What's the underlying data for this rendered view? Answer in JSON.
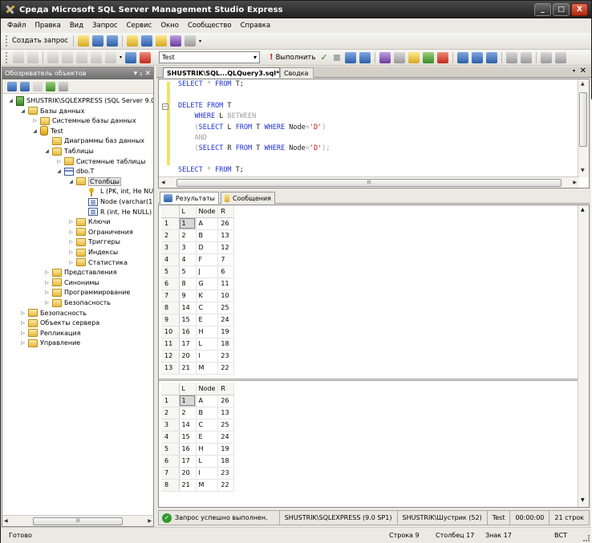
{
  "window": {
    "title": "Среда Microsoft SQL Server Management Studio Express",
    "min": "_",
    "max": "□",
    "close": "X"
  },
  "menu": [
    "Файл",
    "Правка",
    "Вид",
    "Запрос",
    "Сервис",
    "Окно",
    "Сообщество",
    "Справка"
  ],
  "toolbar": {
    "new_query_label": "Создать запрос",
    "database": "Test",
    "execute_label": "Выполнить"
  },
  "object_explorer": {
    "title": "Обозреватель объектов",
    "pin": "▾ ₁ ✕",
    "tree": [
      {
        "label": "SHUSTRIK\\SQLEXPRESS (SQL Server 9.0",
        "depth": 0,
        "twisty": "◢",
        "icon": "server"
      },
      {
        "label": "Базы данных",
        "depth": 1,
        "twisty": "◢",
        "icon": "folder"
      },
      {
        "label": "Системные базы данных",
        "depth": 2,
        "twisty": "▷",
        "icon": "folder"
      },
      {
        "label": "Test",
        "depth": 2,
        "twisty": "◢",
        "icon": "db"
      },
      {
        "label": "Диаграммы баз данных",
        "depth": 3,
        "twisty": "",
        "icon": "folder"
      },
      {
        "label": "Таблицы",
        "depth": 3,
        "twisty": "◢",
        "icon": "folder"
      },
      {
        "label": "Системные таблицы",
        "depth": 4,
        "twisty": "▷",
        "icon": "folder"
      },
      {
        "label": "dbo.T",
        "depth": 4,
        "twisty": "◢",
        "icon": "table"
      },
      {
        "label": "Столбцы",
        "depth": 5,
        "twisty": "◢",
        "icon": "folder",
        "selected": true
      },
      {
        "label": "L (PK, int, Не NUL",
        "depth": 6,
        "twisty": "",
        "icon": "key"
      },
      {
        "label": "Node (varchar(1",
        "depth": 6,
        "twisty": "",
        "icon": "col"
      },
      {
        "label": "R (int, Не NULL)",
        "depth": 6,
        "twisty": "",
        "icon": "col"
      },
      {
        "label": "Ключи",
        "depth": 5,
        "twisty": "▷",
        "icon": "folder"
      },
      {
        "label": "Ограничения",
        "depth": 5,
        "twisty": "▷",
        "icon": "folder"
      },
      {
        "label": "Триггеры",
        "depth": 5,
        "twisty": "▷",
        "icon": "folder"
      },
      {
        "label": "Индексы",
        "depth": 5,
        "twisty": "▷",
        "icon": "folder"
      },
      {
        "label": "Статистика",
        "depth": 5,
        "twisty": "▷",
        "icon": "folder"
      },
      {
        "label": "Представления",
        "depth": 3,
        "twisty": "▷",
        "icon": "folder"
      },
      {
        "label": "Синонимы",
        "depth": 3,
        "twisty": "▷",
        "icon": "folder"
      },
      {
        "label": "Программирование",
        "depth": 3,
        "twisty": "▷",
        "icon": "folder"
      },
      {
        "label": "Безопасность",
        "depth": 3,
        "twisty": "▷",
        "icon": "folder"
      },
      {
        "label": "Безопасность",
        "depth": 1,
        "twisty": "▷",
        "icon": "folder"
      },
      {
        "label": "Объекты сервера",
        "depth": 1,
        "twisty": "▷",
        "icon": "folder"
      },
      {
        "label": "Репликация",
        "depth": 1,
        "twisty": "▷",
        "icon": "folder"
      },
      {
        "label": "Управление",
        "depth": 1,
        "twisty": "▷",
        "icon": "folder"
      }
    ]
  },
  "doc_tabs": {
    "active": "SHUSTRIK\\SQL...QLQuery3.sql*",
    "inactive": "Сводка",
    "close": "✕"
  },
  "editor": {
    "lines": [
      [
        [
          "kw",
          "SELECT "
        ],
        [
          "kg",
          "* "
        ],
        [
          "kw",
          "FROM "
        ],
        [
          "kd",
          "T;"
        ]
      ],
      [],
      [
        [
          "kw",
          "DELETE FROM "
        ],
        [
          "kd",
          "T"
        ]
      ],
      [
        [
          "kd",
          "    "
        ],
        [
          "kw",
          "WHERE "
        ],
        [
          "kd",
          "L "
        ],
        [
          "kg",
          "BETWEEN"
        ]
      ],
      [
        [
          "kd",
          "    "
        ],
        [
          "kg",
          "("
        ],
        [
          "kw",
          "SELECT "
        ],
        [
          "kd",
          "L "
        ],
        [
          "kw",
          "FROM "
        ],
        [
          "kd",
          "T "
        ],
        [
          "kw",
          "WHERE "
        ],
        [
          "kd",
          "Node"
        ],
        [
          "kg",
          "="
        ],
        [
          "ks",
          "'D'"
        ],
        [
          "kg",
          ")"
        ]
      ],
      [
        [
          "kd",
          "    "
        ],
        [
          "kg",
          "AND"
        ]
      ],
      [
        [
          "kd",
          "    "
        ],
        [
          "kg",
          "("
        ],
        [
          "kw",
          "SELECT "
        ],
        [
          "kd",
          "R "
        ],
        [
          "kw",
          "FROM "
        ],
        [
          "kd",
          "T "
        ],
        [
          "kw",
          "WHERE "
        ],
        [
          "kd",
          "Node"
        ],
        [
          "kg",
          "="
        ],
        [
          "ks",
          "'D'"
        ],
        [
          "kg",
          ");"
        ]
      ],
      [],
      [
        [
          "kw",
          "SELECT "
        ],
        [
          "kg",
          "* "
        ],
        [
          "kw",
          "FROM "
        ],
        [
          "kd",
          "T;"
        ]
      ]
    ]
  },
  "result_tabs": {
    "results": "Результаты",
    "messages": "Сообщения"
  },
  "grid1": {
    "headers": [
      "",
      "L",
      "Node",
      "R"
    ],
    "rows": [
      [
        "1",
        "1",
        "A",
        "26"
      ],
      [
        "2",
        "2",
        "B",
        "13"
      ],
      [
        "3",
        "3",
        "D",
        "12"
      ],
      [
        "4",
        "4",
        "F",
        "7"
      ],
      [
        "5",
        "5",
        "J",
        "6"
      ],
      [
        "6",
        "8",
        "G",
        "11"
      ],
      [
        "7",
        "9",
        "K",
        "10"
      ],
      [
        "8",
        "14",
        "C",
        "25"
      ],
      [
        "9",
        "15",
        "E",
        "24"
      ],
      [
        "10",
        "16",
        "H",
        "19"
      ],
      [
        "11",
        "17",
        "L",
        "18"
      ],
      [
        "12",
        "20",
        "I",
        "23"
      ],
      [
        "13",
        "21",
        "M",
        "22"
      ]
    ]
  },
  "grid2": {
    "headers": [
      "",
      "L",
      "Node",
      "R"
    ],
    "rows": [
      [
        "1",
        "1",
        "A",
        "26"
      ],
      [
        "2",
        "2",
        "B",
        "13"
      ],
      [
        "3",
        "14",
        "C",
        "25"
      ],
      [
        "4",
        "15",
        "E",
        "24"
      ],
      [
        "5",
        "16",
        "H",
        "19"
      ],
      [
        "6",
        "17",
        "L",
        "18"
      ],
      [
        "7",
        "20",
        "I",
        "23"
      ],
      [
        "8",
        "21",
        "M",
        "22"
      ]
    ]
  },
  "query_status": {
    "message": "Запрос успешно выполнен.",
    "server": "SHUSTRIK\\SQLEXPRESS (9.0 SP1)",
    "user": "SHUSTRIK\\Шустрик (52)",
    "database": "Test",
    "time": "00:00:00",
    "rows": "21 строк"
  },
  "statusbar": {
    "ready": "Готово",
    "row": "Строка 9",
    "col": "Столбец 17",
    "char": "Знак 17",
    "mode": "ВСТ"
  }
}
